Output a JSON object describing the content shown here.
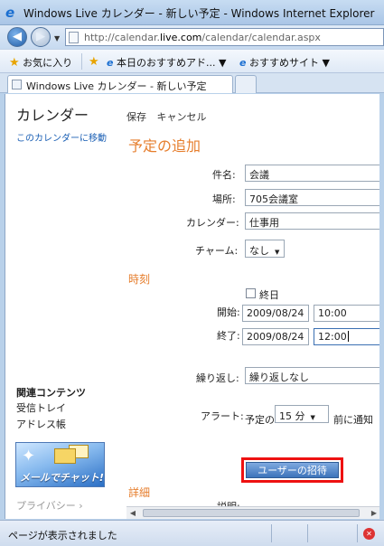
{
  "window": {
    "title": "Windows Live カレンダー - 新しい予定 - Windows Internet Explorer"
  },
  "address": {
    "prefix": "http://calendar.",
    "host": "live.com",
    "path": "/calendar/calendar.aspx"
  },
  "favorites": {
    "favorites_label": "お気に入り",
    "recommend_label": "本日のおすすめアド...",
    "sites_label": "おすすめサイト"
  },
  "tab": {
    "label": "Windows Live カレンダー - 新しい予定"
  },
  "sidebar": {
    "title": "カレンダー",
    "move_link": "このカレンダーに移動",
    "related_heading": "関連コンテンツ",
    "inbox": "受信トレイ",
    "address_book": "アドレス帳",
    "chat_banner": "メールでチャット!",
    "privacy": "プライバシー"
  },
  "toolbar": {
    "save": "保存",
    "cancel": "キャンセル"
  },
  "form": {
    "heading": "予定の追加",
    "subject_label": "件名:",
    "subject_value": "会議",
    "location_label": "場所:",
    "location_value": "705会議室",
    "calendar_label": "カレンダー:",
    "calendar_value": "仕事用",
    "charm_label": "チャーム:",
    "charm_value": "なし",
    "time_section": "時刻",
    "allday_label": "終日",
    "start_label": "開始:",
    "start_date": "2009/08/24",
    "start_time": "10:00",
    "end_label": "終了:",
    "end_date": "2009/08/24",
    "end_time": "12:00",
    "repeat_label": "繰り返し:",
    "repeat_value": "繰り返しなし",
    "alert_label": "アラート:",
    "alert_prefix": "予定の",
    "alert_value": "15 分",
    "alert_suffix": "前に通知",
    "invite_button": "ユーザーの招待",
    "details_section": "詳細",
    "description_label": "説明:"
  },
  "status": {
    "text": "ページが表示されました"
  }
}
